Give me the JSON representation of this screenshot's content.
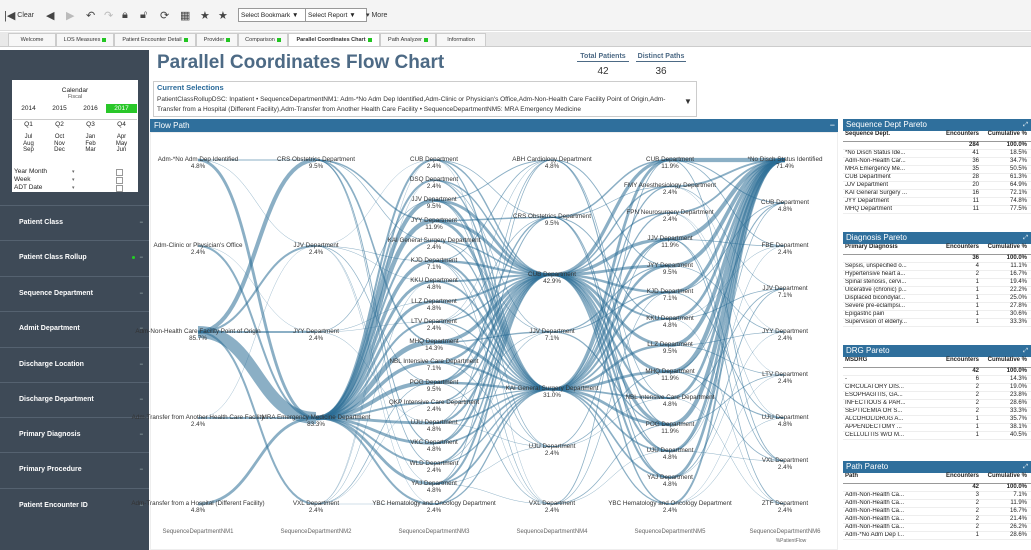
{
  "toolbar": {
    "clear": "Clear",
    "select_bookmark": "Select Bookmark",
    "select_report": "Select Report",
    "more": "More"
  },
  "tabs": [
    {
      "label": "Welcome",
      "dot": false
    },
    {
      "label": "LOS Measures",
      "dot": true
    },
    {
      "label": "Patient Encounter Detail",
      "dot": true
    },
    {
      "label": "Provider",
      "dot": true
    },
    {
      "label": "Comparison",
      "dot": true
    },
    {
      "label": "Parallel Coordinates Chart",
      "dot": true,
      "active": true
    },
    {
      "label": "Path Analyzer",
      "dot": true
    },
    {
      "label": "Information",
      "dot": false
    }
  ],
  "calendar": {
    "title": "Calendar",
    "subtitle": "Fiscal",
    "years": [
      "2014",
      "2015",
      "2016",
      "2017"
    ],
    "selected_year": "2017",
    "quarters": [
      "Q1",
      "Q2",
      "Q3",
      "Q4"
    ],
    "months": [
      [
        "Jul",
        "Aug",
        "Sep"
      ],
      [
        "Oct",
        "Nov",
        "Dec"
      ],
      [
        "Jan",
        "Feb",
        "Mar"
      ],
      [
        "Apr",
        "May",
        "Jun"
      ]
    ],
    "rows": [
      "Year Month",
      "Week",
      "ADT Date"
    ]
  },
  "filters": [
    {
      "label": "Patient Class",
      "active": false
    },
    {
      "label": "Patient Class Rollup",
      "active": true
    },
    {
      "label": "Sequence Department",
      "active": false
    },
    {
      "label": "Admit Department",
      "active": false
    },
    {
      "label": "Discharge Location",
      "active": false
    },
    {
      "label": "Discharge Department",
      "active": false
    },
    {
      "label": "Primary Diagnosis",
      "active": false
    },
    {
      "label": "Primary Procedure",
      "active": false
    },
    {
      "label": "Patient Encounter ID",
      "active": false
    }
  ],
  "header": {
    "title": "Parallel Coordinates Flow Chart",
    "total_patients_label": "Total Patients",
    "total_patients": "42",
    "distinct_paths_label": "Distinct Paths",
    "distinct_paths": "36"
  },
  "current_selections": {
    "title": "Current Selections",
    "text": "PatientClassRollupDSC: Inpatient • SequenceDepartmentNM1: Adm-*No Adm Dep Identified,Adm-Clinic or Physician's Office,Adm-Non-Health Care Facility Point of Origin,Adm-Transfer from a Hospital (Different Facility),Adm-Transfer from Another Health Care Facility • SequenceDepartmentNM5: MRA Emergency Medicine"
  },
  "flow": {
    "title": "Flow Path",
    "axes": [
      "SequenceDepartmentNM1",
      "SequenceDepartmentNM2",
      "SequenceDepartmentNM3",
      "SequenceDepartmentNM4",
      "SequenceDepartmentNM5",
      "SequenceDepartmentNM6"
    ],
    "axis6_sub": "%PatientFlow",
    "nodes": [
      [
        {
          "name": "Adm-*No Adm Dep Identified",
          "pct": "4.8%"
        },
        {
          "name": "Adm-Clinic or Physician's Office",
          "pct": "2.4%"
        },
        {
          "name": "Adm-Non-Health Care Facility Point of Origin",
          "pct": "85.7%"
        },
        {
          "name": "Adm-Transfer from Another Health Care Facility",
          "pct": "2.4%"
        },
        {
          "name": "Adm-Transfer from a Hospital (Different Facility)",
          "pct": "4.8%"
        }
      ],
      [
        {
          "name": "CRS Obstetrics Department",
          "pct": "9.5%"
        },
        {
          "name": "JJV Department",
          "pct": "2.4%"
        },
        {
          "name": "JYY Department",
          "pct": "2.4%"
        },
        {
          "name": "MRA Emergency Medicine Department",
          "pct": "83.3%"
        },
        {
          "name": "VXL Department",
          "pct": "2.4%"
        }
      ],
      [
        {
          "name": "CUB Department",
          "pct": "2.4%"
        },
        {
          "name": "DSQ Department",
          "pct": "2.4%"
        },
        {
          "name": "JJV Department",
          "pct": "9.5%"
        },
        {
          "name": "JYY Department",
          "pct": "11.9%"
        },
        {
          "name": "KAI General Surgery Department",
          "pct": "2.4%"
        },
        {
          "name": "KJD Department",
          "pct": "7.1%"
        },
        {
          "name": "KKU Department",
          "pct": "4.8%"
        },
        {
          "name": "LLZ Department",
          "pct": "4.8%"
        },
        {
          "name": "LTV Department",
          "pct": "2.4%"
        },
        {
          "name": "MHQ Department",
          "pct": "14.3%"
        },
        {
          "name": "NBL Intensive Care Department",
          "pct": "7.1%"
        },
        {
          "name": "POG Department",
          "pct": "9.5%"
        },
        {
          "name": "QKP Intensive Care Department",
          "pct": "2.4%"
        },
        {
          "name": "UJU Department",
          "pct": "4.8%"
        },
        {
          "name": "VKC Department",
          "pct": "4.8%"
        },
        {
          "name": "WLD Department",
          "pct": "2.4%"
        },
        {
          "name": "YAJ Department",
          "pct": "4.8%"
        },
        {
          "name": "YBC Hematology and Oncology Department",
          "pct": "2.4%"
        }
      ],
      [
        {
          "name": "ABH Cardiology Department",
          "pct": "4.8%"
        },
        {
          "name": "CRS Obstetrics Department",
          "pct": "9.5%"
        },
        {
          "name": "CUB Department",
          "pct": "42.9%"
        },
        {
          "name": "JJV Department",
          "pct": "7.1%"
        },
        {
          "name": "KAI General Surgery Department",
          "pct": "31.0%"
        },
        {
          "name": "UJU Department",
          "pct": "2.4%"
        },
        {
          "name": "VXL Department",
          "pct": "2.4%"
        }
      ],
      [
        {
          "name": "CUB Department",
          "pct": "11.9%"
        },
        {
          "name": "FMY Anesthesiology Department",
          "pct": "2.4%"
        },
        {
          "name": "FPN Neurosurgery Department",
          "pct": "2.4%"
        },
        {
          "name": "JJV Department",
          "pct": "11.9%"
        },
        {
          "name": "JYY Department",
          "pct": "9.5%"
        },
        {
          "name": "KJD Department",
          "pct": "7.1%"
        },
        {
          "name": "KKU Department",
          "pct": "4.8%"
        },
        {
          "name": "LLZ Department",
          "pct": "9.5%"
        },
        {
          "name": "MHQ Department",
          "pct": "11.9%"
        },
        {
          "name": "NBL Intensive Care Department",
          "pct": "4.8%"
        },
        {
          "name": "POG Department",
          "pct": "11.9%"
        },
        {
          "name": "UJU Department",
          "pct": "4.8%"
        },
        {
          "name": "YAJ Department",
          "pct": "4.8%"
        },
        {
          "name": "YBC Hematology and Oncology Department",
          "pct": "2.4%"
        }
      ],
      [
        {
          "name": "*No Disch Status Identified",
          "pct": "71.4%"
        },
        {
          "name": "CUB Department",
          "pct": "4.8%"
        },
        {
          "name": "FBE Department",
          "pct": "2.4%"
        },
        {
          "name": "JJV Department",
          "pct": "7.1%"
        },
        {
          "name": "JYY Department",
          "pct": "2.4%"
        },
        {
          "name": "LTV Department",
          "pct": "2.4%"
        },
        {
          "name": "UJU Department",
          "pct": "4.8%"
        },
        {
          "name": "VXL Department",
          "pct": "2.4%"
        },
        {
          "name": "ZTF Department",
          "pct": "2.4%"
        }
      ]
    ]
  },
  "paretos": [
    {
      "title": "Sequence Dept Pareto",
      "cols": [
        "Sequence Dept.",
        "Encounters",
        "Cumulative %"
      ],
      "total": [
        "",
        "284",
        "100.0%"
      ],
      "rows": [
        [
          "*No Disch Status Ide...",
          "41",
          "18.5%"
        ],
        [
          "Adm-Non-Health Car...",
          "36",
          "34.7%"
        ],
        [
          "MRA Emergency Me...",
          "35",
          "50.5%"
        ],
        [
          "CUB Department",
          "28",
          "61.3%"
        ],
        [
          "JJV Department",
          "20",
          "64.9%"
        ],
        [
          "KAI General Surgery ...",
          "16",
          "72.1%"
        ],
        [
          "JYY Department",
          "11",
          "74.8%"
        ],
        [
          "MHQ Department",
          "11",
          "77.5%"
        ]
      ]
    },
    {
      "title": "Diagnosis Pareto",
      "cols": [
        "Primary Diagnosis",
        "Encounters",
        "Cumulative %"
      ],
      "total": [
        "",
        "36",
        "100.0%"
      ],
      "rows": [
        [
          "Sepsis, unspecified o...",
          "4",
          "11.1%"
        ],
        [
          "Hypertensive heart a...",
          "2",
          "16.7%"
        ],
        [
          "Spinal stenosis, cervi...",
          "1",
          "19.4%"
        ],
        [
          "Ulcerative (chronic) p...",
          "1",
          "22.2%"
        ],
        [
          "Displaced bicondylar...",
          "1",
          "25.0%"
        ],
        [
          "Severe pre-eclampsi...",
          "1",
          "27.8%"
        ],
        [
          "Epigastric pain",
          "1",
          "30.6%"
        ],
        [
          "Supervision of elderly...",
          "1",
          "33.3%"
        ]
      ]
    },
    {
      "title": "DRG Pareto",
      "cols": [
        "MSDRG",
        "Encounters",
        "Cumulative %"
      ],
      "total": [
        "",
        "42",
        "100.0%"
      ],
      "rows": [
        [
          "-",
          "6",
          "14.3%"
        ],
        [
          "CIRCULATORY DIS...",
          "2",
          "19.0%"
        ],
        [
          "ESOPHAGITIS, GA...",
          "2",
          "23.8%"
        ],
        [
          "INFECTIOUS & PAR...",
          "2",
          "28.6%"
        ],
        [
          "SEPTICEMIA OR S...",
          "2",
          "33.3%"
        ],
        [
          "ALCOHOL/DRUG A...",
          "1",
          "35.7%"
        ],
        [
          "APPENDECTOMY ...",
          "1",
          "38.1%"
        ],
        [
          "CELLULITIS W/O M...",
          "1",
          "40.5%"
        ]
      ]
    },
    {
      "title": "Path Pareto",
      "cols": [
        "Path",
        "Encounters",
        "Cumulative %"
      ],
      "total": [
        "",
        "42",
        "100.0%"
      ],
      "rows": [
        [
          "Adm-Non-Health Ca...",
          "3",
          "7.1%"
        ],
        [
          "Adm-Non-Health Ca...",
          "2",
          "11.9%"
        ],
        [
          "Adm-Non-Health Ca...",
          "2",
          "16.7%"
        ],
        [
          "Adm-Non-Health Ca...",
          "2",
          "21.4%"
        ],
        [
          "Adm-Non-Health Ca...",
          "2",
          "26.2%"
        ],
        [
          "Adm-*No Adm Dep I...",
          "1",
          "28.6%"
        ]
      ]
    }
  ],
  "colors": {
    "accent": "#2f6f9c",
    "sidebar": "#3e4a57",
    "flow": "#2b6d96",
    "selected": "#29c729"
  }
}
